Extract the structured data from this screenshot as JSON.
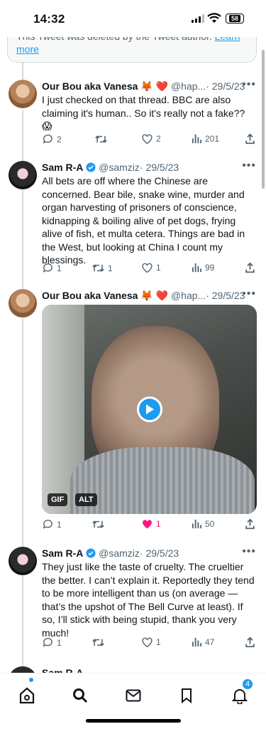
{
  "status_bar": {
    "time": "14:32",
    "battery": "58"
  },
  "deleted_notice": {
    "text": "This Tweet was deleted by the Tweet author.",
    "link": "Learn more"
  },
  "tweets": [
    {
      "name": "Our Bou aka Vanesa",
      "emoji": "🦊 ❤️",
      "handle": "@hap...",
      "date": "· 29/5/23",
      "text": "I just checked on that thread. BBC are also claiming it's human.. So it's really not a fake?? 😱",
      "replies": "2",
      "retweets": "",
      "likes": "2",
      "views": "201"
    },
    {
      "name": "Sam R-A",
      "handle": "@samziz",
      "date": "· 29/5/23",
      "text": "All bets are off where the Chinese are concerned. Bear bile, snake wine, murder and organ harvesting of prisoners of conscience, kidnapping & boiling alive of pet dogs, frying alive of fish, et multa cetera. Things are bad in the West, but looking at China I count my blessings.",
      "replies": "1",
      "retweets": "1",
      "likes": "1",
      "views": "99"
    },
    {
      "name": "Our Bou aka Vanesa",
      "emoji": "🦊 ❤️",
      "handle": "@hap...",
      "date": "· 29/5/23",
      "media_badges": [
        "GIF",
        "ALT"
      ],
      "replies": "1",
      "retweets": "",
      "likes": "1",
      "views": "50",
      "liked": true
    },
    {
      "name": "Sam R-A",
      "handle": "@samziz",
      "date": "· 29/5/23",
      "text": "They just like the taste of cruelty. The crueltier the better. I can’t explain it. Reportedly they tend to be more intelligent than us (on average — that’s the upshot of The Bell Curve at least). If so, I’ll stick with being stupid, thank you very much!",
      "replies": "1",
      "retweets": "",
      "likes": "1",
      "views": "47"
    }
  ],
  "partial_tweet": {
    "name": "Sam R-A"
  },
  "tab_bar": {
    "items": [
      "home-icon",
      "search-icon",
      "messages-icon",
      "bookmarks-icon",
      "notifications-icon"
    ],
    "notification_count": "4"
  },
  "colors": {
    "accent": "#1d9bf0",
    "like": "#f91880",
    "text": "#0f1419",
    "muted": "#536471"
  }
}
